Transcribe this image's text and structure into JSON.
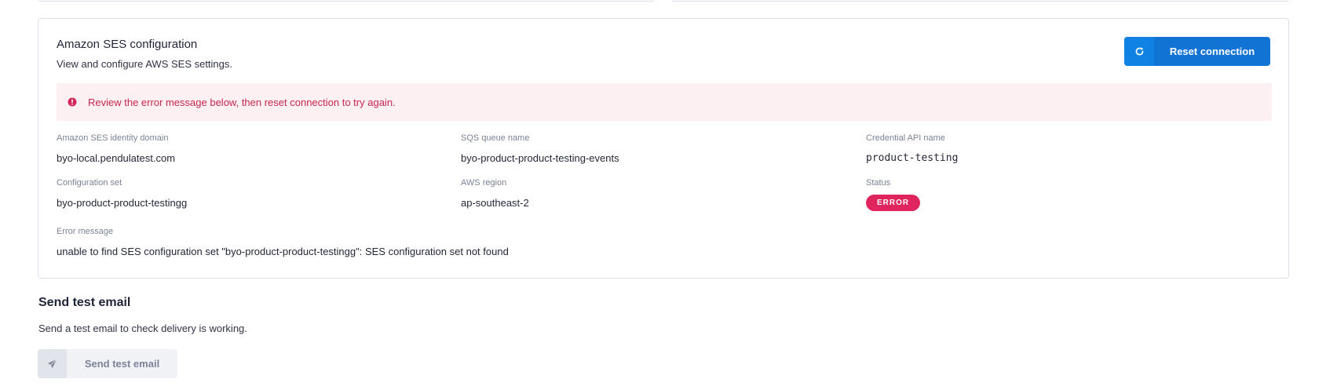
{
  "ses_config": {
    "title": "Amazon SES configuration",
    "subtitle": "View and configure AWS SES settings.",
    "reset_button_label": "Reset connection",
    "alert_text": "Review the error message below, then reset connection to try again.",
    "fields": {
      "identity_domain": {
        "label": "Amazon SES identity domain",
        "value": "byo-local.pendulatest.com"
      },
      "sqs_queue": {
        "label": "SQS queue name",
        "value": "byo-product-product-testing-events"
      },
      "credential_api": {
        "label": "Credential API name",
        "value": "product-testing"
      },
      "configuration_set": {
        "label": "Configuration set",
        "value": "byo-product-product-testingg"
      },
      "aws_region": {
        "label": "AWS region",
        "value": "ap-southeast-2"
      },
      "status": {
        "label": "Status",
        "value": "ERROR"
      },
      "error_message": {
        "label": "Error message",
        "value": "unable to find SES configuration set \"byo-product-product-testingg\": SES configuration set not found"
      }
    },
    "icons": {
      "reset": "refresh-icon",
      "alert": "error-circle-icon"
    }
  },
  "send_test": {
    "title": "Send test email",
    "description": "Send a test email to check delivery is working.",
    "button_label": "Send test email",
    "icon": "paper-plane-icon"
  },
  "colors": {
    "primary": "#1173d4",
    "error": "#e0245e",
    "alert_bg": "#fdf0f2",
    "alert_text": "#c8264f",
    "disabled_bg": "#f0f2f6"
  }
}
